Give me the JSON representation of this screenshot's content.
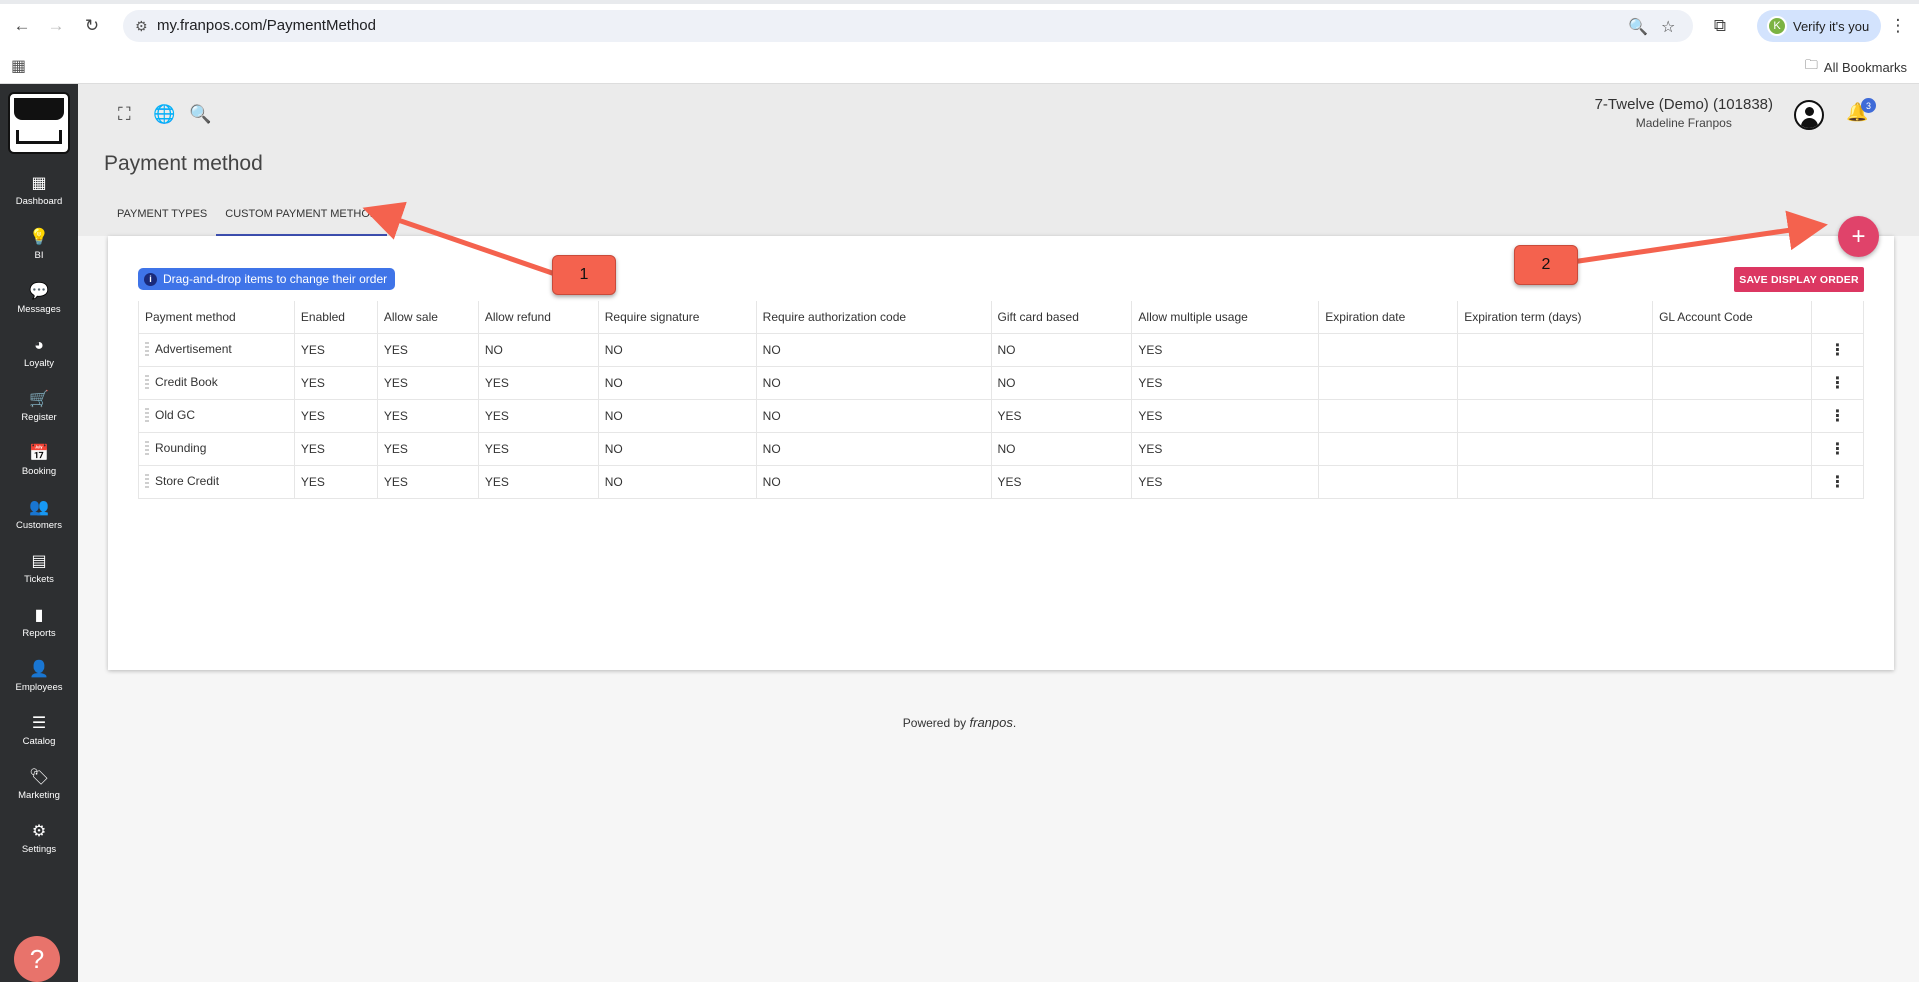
{
  "browser": {
    "url": "my.franpos.com/PaymentMethod",
    "verify_label": "Verify it's you",
    "verify_avatar": "K",
    "bookmarks_label": "All Bookmarks"
  },
  "sidebar": {
    "items": [
      {
        "label": "Dashboard",
        "icon": "▦"
      },
      {
        "label": "BI",
        "icon": "💡"
      },
      {
        "label": "Messages",
        "icon": "💬"
      },
      {
        "label": "Loyalty",
        "icon": "◕"
      },
      {
        "label": "Register",
        "icon": "🛒"
      },
      {
        "label": "Booking",
        "icon": "📅"
      },
      {
        "label": "Customers",
        "icon": "👥"
      },
      {
        "label": "Tickets",
        "icon": "▤"
      },
      {
        "label": "Reports",
        "icon": "▮"
      },
      {
        "label": "Employees",
        "icon": "👤"
      },
      {
        "label": "Catalog",
        "icon": "☰"
      },
      {
        "label": "Marketing",
        "icon": "🏷"
      },
      {
        "label": "Settings",
        "icon": "⚙"
      }
    ],
    "help_label": "?"
  },
  "header": {
    "org_name": "7-Twelve (Demo) (101838)",
    "user_name": "Madeline Franpos",
    "notification_count": "3"
  },
  "page": {
    "title": "Payment method",
    "tabs": [
      {
        "label": "PAYMENT TYPES",
        "active": false
      },
      {
        "label": "CUSTOM PAYMENT METHOD",
        "active": true
      }
    ],
    "info_text": "Drag-and-drop items to change their order",
    "save_label": "SAVE DISPLAY ORDER",
    "add_label": "+"
  },
  "table": {
    "columns": [
      "Payment method",
      "Enabled",
      "Allow sale",
      "Allow refund",
      "Require signature",
      "Require authorization code",
      "Gift card based",
      "Allow multiple usage",
      "Expiration date",
      "Expiration term (days)",
      "GL Account Code",
      ""
    ],
    "rows": [
      {
        "name": "Advertisement",
        "enabled": "YES",
        "allow_sale": "YES",
        "allow_refund": "NO",
        "require_signature": "NO",
        "require_auth": "NO",
        "gift_card": "NO",
        "multi_use": "YES",
        "exp_date": "",
        "exp_term": "",
        "gl_code": ""
      },
      {
        "name": "Credit Book",
        "enabled": "YES",
        "allow_sale": "YES",
        "allow_refund": "YES",
        "require_signature": "NO",
        "require_auth": "NO",
        "gift_card": "NO",
        "multi_use": "YES",
        "exp_date": "",
        "exp_term": "",
        "gl_code": ""
      },
      {
        "name": "Old GC",
        "enabled": "YES",
        "allow_sale": "YES",
        "allow_refund": "YES",
        "require_signature": "NO",
        "require_auth": "NO",
        "gift_card": "YES",
        "multi_use": "YES",
        "exp_date": "",
        "exp_term": "",
        "gl_code": ""
      },
      {
        "name": "Rounding",
        "enabled": "YES",
        "allow_sale": "YES",
        "allow_refund": "YES",
        "require_signature": "NO",
        "require_auth": "NO",
        "gift_card": "NO",
        "multi_use": "YES",
        "exp_date": "",
        "exp_term": "",
        "gl_code": ""
      },
      {
        "name": "Store Credit",
        "enabled": "YES",
        "allow_sale": "YES",
        "allow_refund": "YES",
        "require_signature": "NO",
        "require_auth": "NO",
        "gift_card": "YES",
        "multi_use": "YES",
        "exp_date": "",
        "exp_term": "",
        "gl_code": ""
      }
    ]
  },
  "footer": {
    "prefix": "Powered by",
    "brand": "franpos",
    "suffix": "."
  },
  "annotations": {
    "callout_1": "1",
    "callout_2": "2",
    "color": "#f4624e"
  },
  "colors": {
    "sidebar_bg": "#2d2f31",
    "accent_pink": "#dc3762",
    "yes": "#3a9a2f",
    "no": "#e0332b",
    "tab_underline": "#3f51b5"
  }
}
